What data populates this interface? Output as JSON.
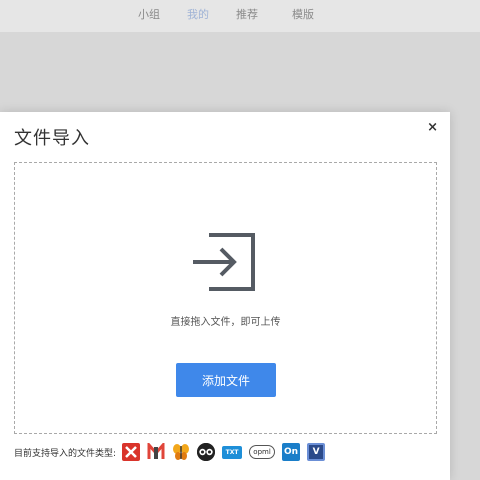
{
  "nav": {
    "items": [
      {
        "label": "小组"
      },
      {
        "label": "我的"
      },
      {
        "label": "推荐"
      },
      {
        "label": "模版"
      }
    ]
  },
  "modal": {
    "title": "文件导入",
    "close": "×",
    "drop_hint": "直接拖入文件，即可上传",
    "add_button": "添加文件",
    "supported_label": "目前支持导入的文件类型:",
    "file_types": [
      {
        "icon": "xmind-icon",
        "label": ""
      },
      {
        "icon": "mindnode-icon",
        "label": ""
      },
      {
        "icon": "butterfly-icon",
        "label": ""
      },
      {
        "icon": "owl-icon",
        "label": ""
      },
      {
        "icon": "txt-icon",
        "label": "TXT"
      },
      {
        "icon": "opml-icon",
        "label": "opml"
      },
      {
        "icon": "onenote-icon",
        "label": "On"
      },
      {
        "icon": "visio-icon",
        "label": "V"
      }
    ]
  },
  "colors": {
    "accent": "#3f88ea",
    "active_nav": "#9fb3d6"
  }
}
